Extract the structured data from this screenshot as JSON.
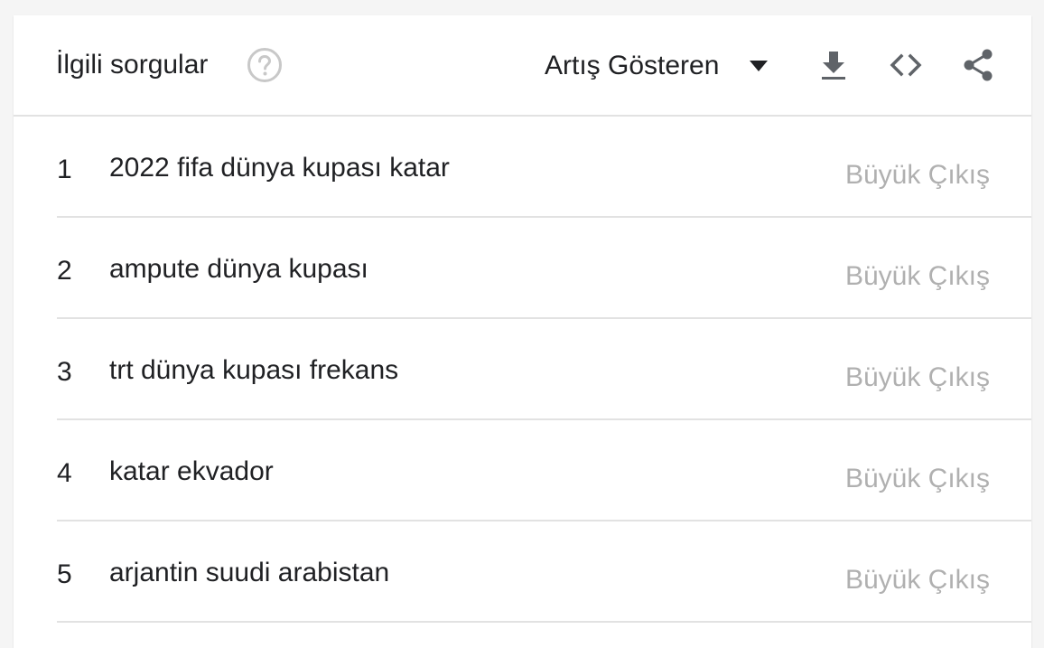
{
  "header": {
    "title": "İlgili sorgular",
    "help_icon": "help-circle-icon",
    "dropdown_label": "Artış Gösteren",
    "dropdown_icon": "caret-down-icon",
    "actions": [
      "download-icon",
      "embed-code-icon",
      "share-icon"
    ]
  },
  "rows": [
    {
      "rank": "1",
      "query": "2022 fifa dünya kupası katar",
      "value": "Büyük Çıkış"
    },
    {
      "rank": "2",
      "query": "ampute dünya kupası",
      "value": "Büyük Çıkış"
    },
    {
      "rank": "3",
      "query": "trt dünya kupası frekans",
      "value": "Büyük Çıkış"
    },
    {
      "rank": "4",
      "query": "katar ekvador",
      "value": "Büyük Çıkış"
    },
    {
      "rank": "5",
      "query": "arjantin suudi arabistan",
      "value": "Büyük Çıkış"
    }
  ],
  "colors": {
    "text": "#202124",
    "muted": "#b0b0b0",
    "icon": "#5f6368",
    "help_icon": "#c8c8c8",
    "divider": "#e2e2e2"
  }
}
